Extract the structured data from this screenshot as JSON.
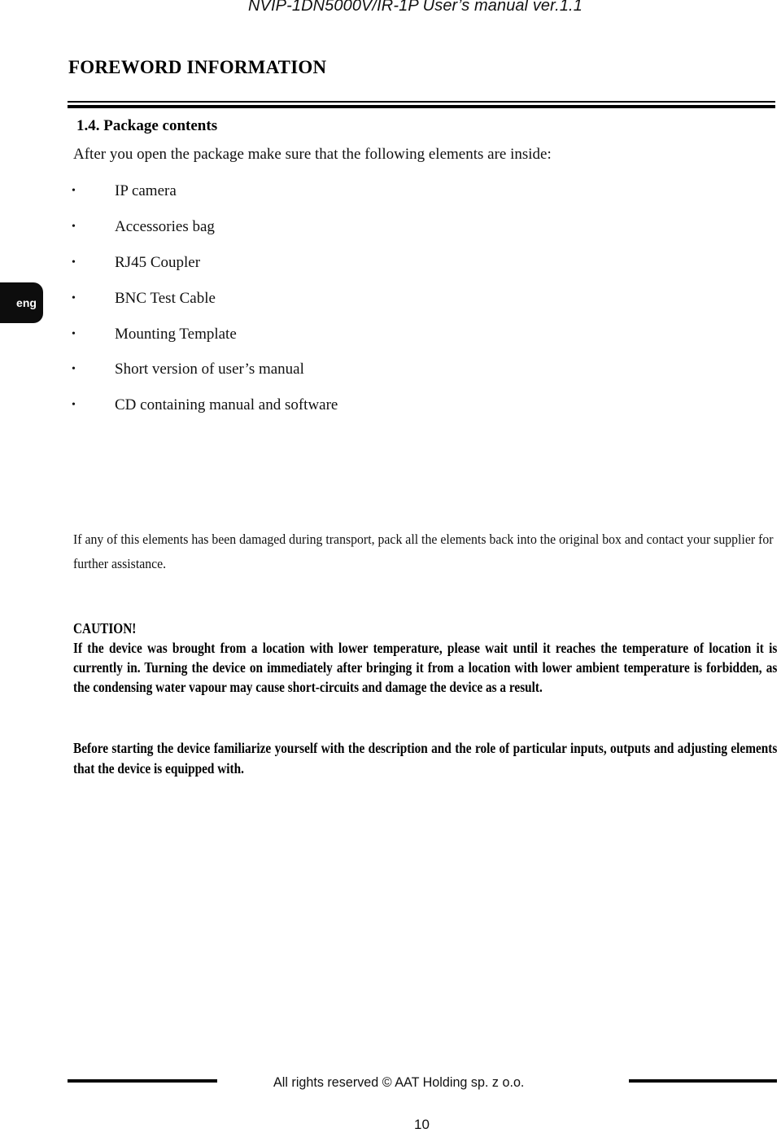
{
  "header": {
    "running_title": "NVIP-1DN5000V/IR-1P User’s manual ver.1.1"
  },
  "chapter": {
    "title": "FOREWORD INFORMATION"
  },
  "section": {
    "heading": "1.4. Package contents",
    "intro": "After you open the package make sure that the following elements are inside:",
    "items": [
      {
        "label": "IP camera"
      },
      {
        "label": "Accessories bag"
      },
      {
        "label": "RJ45 Coupler"
      },
      {
        "label": "BNC Test Cable"
      },
      {
        "label": "Mounting Template"
      },
      {
        "label": "Short version of user’s manual"
      },
      {
        "label": "CD containing manual and software"
      }
    ],
    "bullet_glyph": "•",
    "damage_note": "If any of this elements has been damaged during transport, pack all the elements back into the original box and contact your supplier for further assistance."
  },
  "side_tab": {
    "language": "eng"
  },
  "caution": {
    "title": "CAUTION!",
    "text": "If the device was brought from a location with lower temperature, please wait until it reaches the temperature of location it is currently in. Turning the device on immediately after bringing it from a location with lower ambient temperature is forbidden, as the condensing water vapour may cause short-circuits and damage the device as a result."
  },
  "before_starting": {
    "text": "Before starting the device familiarize yourself with the description and the role of particular inputs, outputs and adjusting elements that the device is equipped with."
  },
  "footer": {
    "copyright": "All rights reserved © AAT Holding sp. z o.o.",
    "page_number": "10"
  }
}
